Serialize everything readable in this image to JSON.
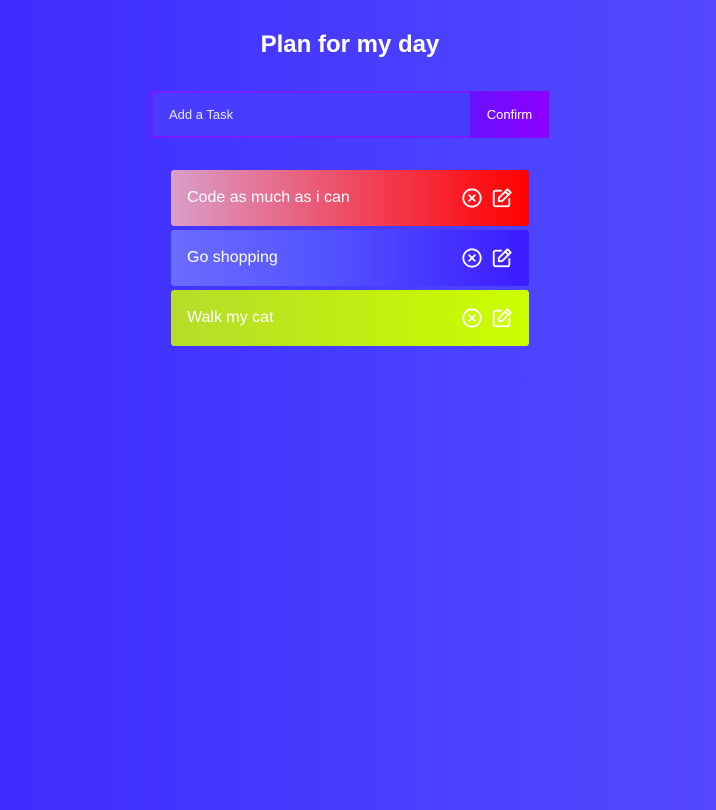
{
  "header": {
    "title": "Plan for my day"
  },
  "form": {
    "input_placeholder": "Add a Task",
    "input_value": "",
    "confirm_label": "Confirm"
  },
  "tasks": [
    {
      "text": "Code as much as i can"
    },
    {
      "text": "Go shopping"
    },
    {
      "text": "Walk my cat"
    }
  ],
  "icons": {
    "delete": "close-circle-icon",
    "edit": "edit-icon"
  },
  "colors": {
    "background": "#4433ff",
    "confirm_button": "#8100ff",
    "input_border": "#7a1bff",
    "task_1_accent": "#ff0000",
    "task_2_accent": "#3b1bff",
    "task_3_accent": "#ccff00"
  }
}
